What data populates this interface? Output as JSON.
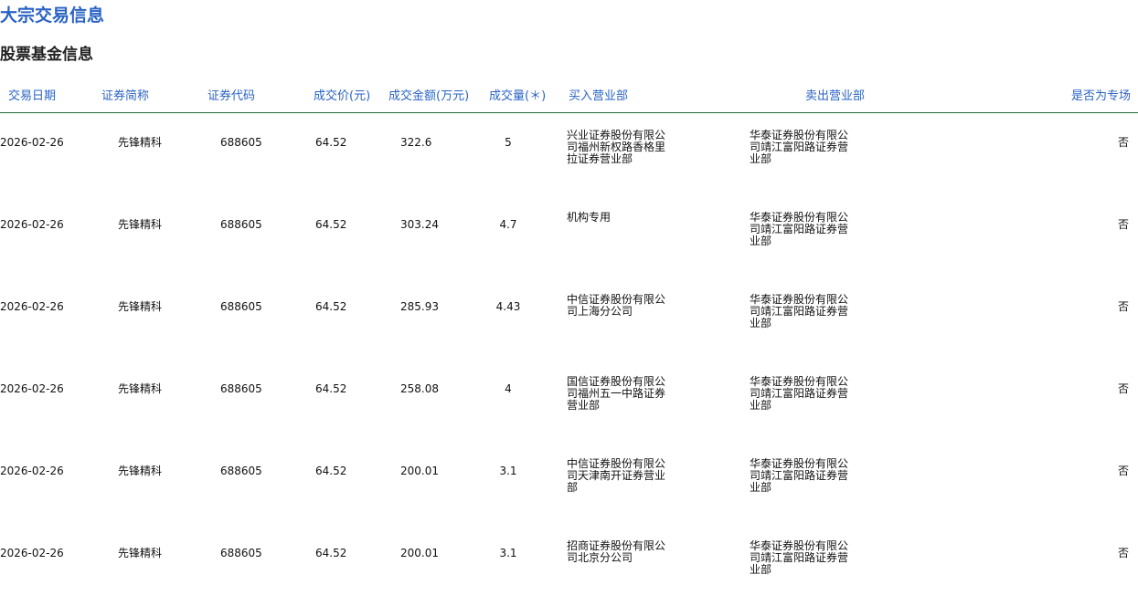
{
  "page_title": "大宗交易信息",
  "section_title": "股票基金信息",
  "columns": [
    "交易日期",
    "证券简称",
    "证券代码",
    "成交价(元)",
    "成交金额(万元)",
    "成交量(＊)",
    "买入营业部",
    "卖出营业部",
    "是否为专场"
  ],
  "rows": [
    {
      "date": "2026-02-26",
      "name": "先锋精科",
      "code": "688605",
      "price": "64.52",
      "amount": "322.6",
      "volume": "5",
      "buyer": "兴业证券股份有限公司福州新权路香格里拉证券营业部",
      "seller": "华泰证券股份有限公司靖江富阳路证券营业部",
      "special": "否"
    },
    {
      "date": "2026-02-26",
      "name": "先锋精科",
      "code": "688605",
      "price": "64.52",
      "amount": "303.24",
      "volume": "4.7",
      "buyer": "机构专用",
      "seller": "华泰证券股份有限公司靖江富阳路证券营业部",
      "special": "否"
    },
    {
      "date": "2026-02-26",
      "name": "先锋精科",
      "code": "688605",
      "price": "64.52",
      "amount": "285.93",
      "volume": "4.43",
      "buyer": "中信证券股份有限公司上海分公司",
      "seller": "华泰证券股份有限公司靖江富阳路证券营业部",
      "special": "否"
    },
    {
      "date": "2026-02-26",
      "name": "先锋精科",
      "code": "688605",
      "price": "64.52",
      "amount": "258.08",
      "volume": "4",
      "buyer": "国信证券股份有限公司福州五一中路证券营业部",
      "seller": "华泰证券股份有限公司靖江富阳路证券营业部",
      "special": "否"
    },
    {
      "date": "2026-02-26",
      "name": "先锋精科",
      "code": "688605",
      "price": "64.52",
      "amount": "200.01",
      "volume": "3.1",
      "buyer": "中信证券股份有限公司天津南开证券营业部",
      "seller": "华泰证券股份有限公司靖江富阳路证券营业部",
      "special": "否"
    },
    {
      "date": "2026-02-26",
      "name": "先锋精科",
      "code": "688605",
      "price": "64.52",
      "amount": "200.01",
      "volume": "3.1",
      "buyer": "招商证券股份有限公司北京分公司",
      "seller": "华泰证券股份有限公司靖江富阳路证券营业部",
      "special": "否"
    }
  ],
  "colors": {
    "link_blue": "#2a63c6",
    "header_rule": "#1e6b3a"
  }
}
